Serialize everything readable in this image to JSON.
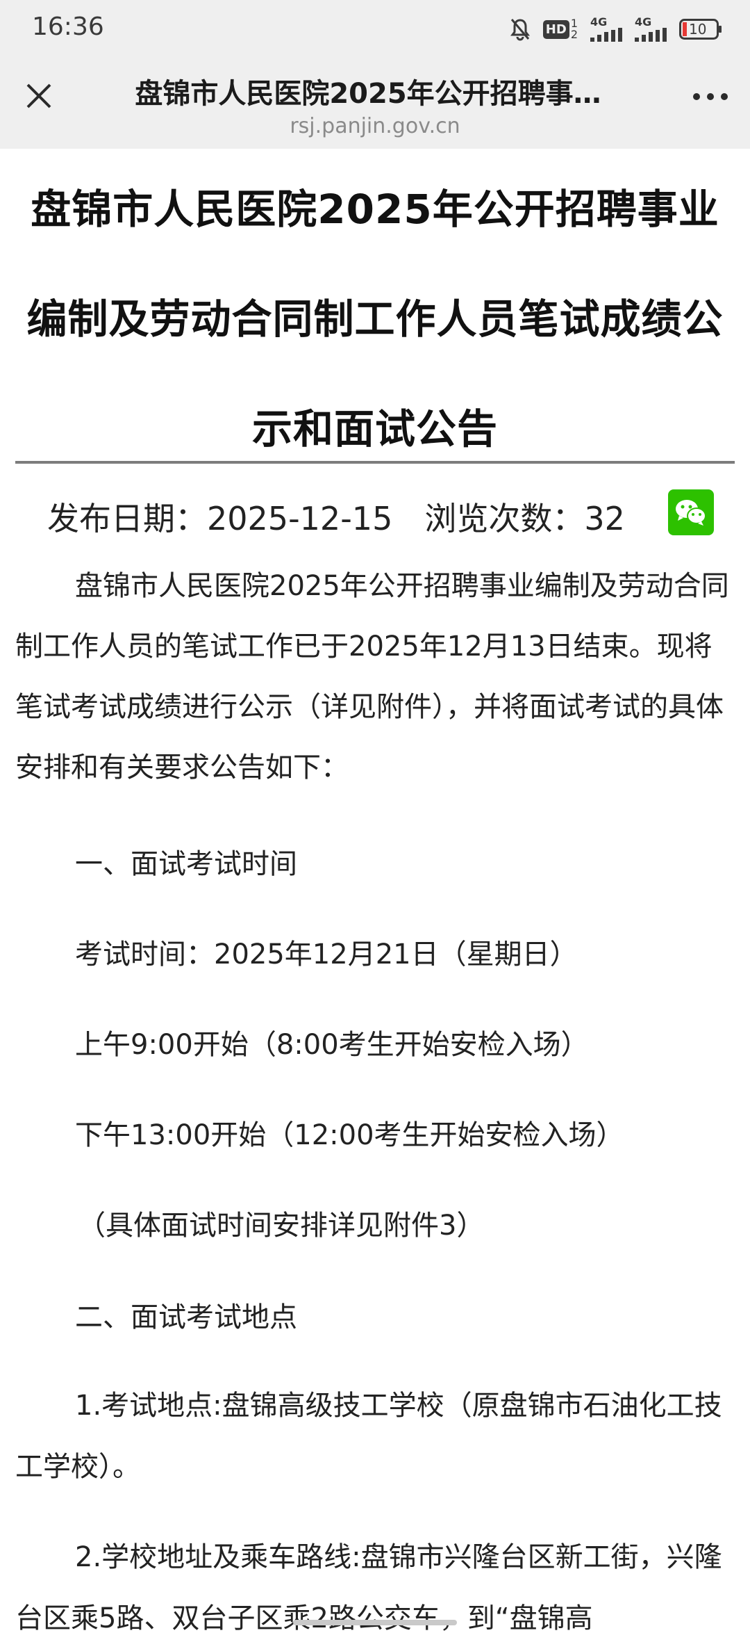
{
  "status_bar": {
    "time": "16:36",
    "hd_label": "HD",
    "net1": "4G",
    "net2": "4G",
    "battery": "10",
    "icons": [
      "mute-bell-icon",
      "hd-icon",
      "signal-icon",
      "signal-icon",
      "battery-icon"
    ]
  },
  "nav": {
    "title": "盘锦市人民医院2025年公开招聘事…",
    "url": "rsj.panjin.gov.cn",
    "icons": [
      "close-icon",
      "more-icon"
    ]
  },
  "article": {
    "title": "盘锦市人民医院2025年公开招聘事业编制及劳动合同制工作人员笔试成绩公示和面试公告",
    "date_label": "发布日期：2025-12-15",
    "views_label": "浏览次数：32",
    "share_icon": "wechat-icon",
    "intro": "盘锦市人民医院2025年公开招聘事业编制及劳动合同制工作人员的笔试工作已于2025年12月13日结束。现将笔试考试成绩进行公示（详见附件），并将面试考试的具体安排和有关要求公告如下：",
    "section1_heading": "一、面试考试时间",
    "exam_time": "考试时间：2025年12月21日（星期日）",
    "morning": "上午9:00开始（8:00考生开始安检入场）",
    "afternoon": "下午13:00开始（12:00考生开始安检入场）",
    "schedule_note": "（具体面试时间安排详见附件3）",
    "section2_heading": "二、面试考试地点",
    "location": "1.考试地点:盘锦高级技工学校（原盘锦市石油化工技工学校）。",
    "address": "2.学校地址及乘车路线:盘锦市兴隆台区新工街，兴隆台区乘5路、双台子区乘2路公交车，到“盘锦高"
  },
  "colors": {
    "chrome_bg": "#efefef",
    "wechat_green": "#2dc100",
    "battery_red": "#e53935"
  }
}
